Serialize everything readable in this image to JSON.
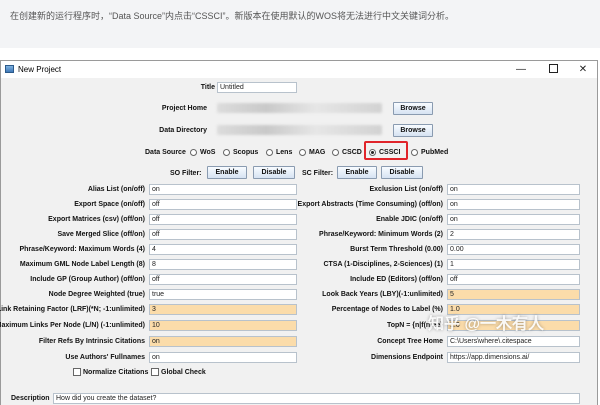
{
  "caption": "在创建新的运行程序时，“Data Source”内点击“CSSCI”。新版本在使用默认的WOS将无法进行中文关键词分析。",
  "window": {
    "title": "New Project",
    "controls": {
      "minimize": "—",
      "close": "✕"
    }
  },
  "project": {
    "title_label": "Title",
    "title_value": "Untitled",
    "home_label": "Project Home",
    "home_browse": "Browse",
    "data_dir_label": "Data Directory",
    "data_browse": "Browse"
  },
  "data_source": {
    "label": "Data Source",
    "options": [
      "WoS",
      "Scopus",
      "Lens",
      "MAG",
      "CSCD",
      "CSSCI",
      "PubMed"
    ],
    "selected": "CSSCI"
  },
  "filters": {
    "so_label": "SO Filter:",
    "so_enable": "Enable",
    "so_disable": "Disable",
    "sc_label": "SC Filter:",
    "sc_enable": "Enable",
    "sc_disable": "Disable"
  },
  "left_params": [
    {
      "label": "Alias List (on/off)",
      "value": "on",
      "highlight": false
    },
    {
      "label": "Export Space (on/off)",
      "value": "off",
      "highlight": false
    },
    {
      "label": "Export Matrices (csv) (off/on)",
      "value": "off",
      "highlight": false
    },
    {
      "label": "Save Merged Slice (off/on)",
      "value": "off",
      "highlight": false
    },
    {
      "label": "Phrase/Keyword: Maximum Words (4)",
      "value": "4",
      "highlight": false
    },
    {
      "label": "Maximum GML Node Label Length (8)",
      "value": "8",
      "highlight": false
    },
    {
      "label": "Include GP (Group Author) (off/on)",
      "value": "off",
      "highlight": false
    },
    {
      "label": "Node Degree Weighted (true)",
      "value": "true",
      "highlight": false
    },
    {
      "label": "Link Retaining Factor (LRF)(*N; -1:unlimited)",
      "value": "3",
      "highlight": true
    },
    {
      "label": "Maximum Links Per Node (L/N) (-1:unlimited)",
      "value": "10",
      "highlight": true
    },
    {
      "label": "Filter Refs By Intrinsic Citations",
      "value": "on",
      "highlight": true
    },
    {
      "label": "Use Authors' Fullnames",
      "value": "on",
      "highlight": false
    }
  ],
  "right_params": [
    {
      "label": "Exclusion List (on/off)",
      "value": "on",
      "highlight": false
    },
    {
      "label": "Export Abstracts (Time Consuming) (off/on)",
      "value": "on",
      "highlight": false
    },
    {
      "label": "Enable JDIC (on/off)",
      "value": "on",
      "highlight": false
    },
    {
      "label": "Phrase/Keyword: Minimum Words (2)",
      "value": "2",
      "highlight": false
    },
    {
      "label": "Burst Term Threshold (0.00)",
      "value": "0.00",
      "highlight": false
    },
    {
      "label": "CTSA (1-Disciplines, 2-Sciences) (1)",
      "value": "1",
      "highlight": false
    },
    {
      "label": "Include ED (Editors) (off/on)",
      "value": "off",
      "highlight": false
    },
    {
      "label": "Look Back Years (LBY)(-1:unlimited)",
      "value": "5",
      "highlight": true
    },
    {
      "label": "Percentage of Nodes to Label (%)",
      "value": "1.0",
      "highlight": true
    },
    {
      "label": "TopN = {n|f(n)≥e}",
      "value": "1.0",
      "highlight": true
    },
    {
      "label": "Concept Tree Home",
      "value": "C:\\Users\\where\\.citespace",
      "highlight": false
    },
    {
      "label": "Dimensions Endpoint",
      "value": "https://app.dimensions.ai/",
      "highlight": false
    }
  ],
  "checkboxes": {
    "normalize": "Normalize Citations",
    "global": "Global Check"
  },
  "description": {
    "label": "Description",
    "value": "How did you create the dataset?"
  },
  "watermark": "知乎 @一木有人",
  "colors": {
    "highlight_field": "#fbdcaa",
    "selection_box": "#e0242a",
    "button_top": "#f8fbff",
    "button_bottom": "#d6e3f2"
  }
}
